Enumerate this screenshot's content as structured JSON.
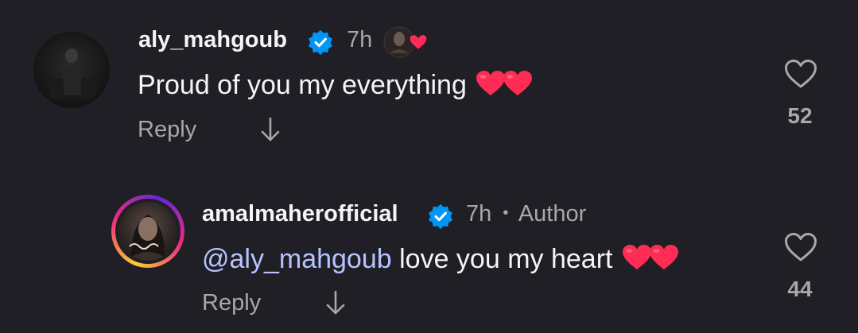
{
  "comments": [
    {
      "username": "aly_mahgoub",
      "time": "7h",
      "text": "Proud of you my everything",
      "reply_label": "Reply",
      "like_count": "52"
    },
    {
      "username": "amalmaherofficial",
      "time": "7h",
      "separator": "•",
      "author_label": "Author",
      "mention": "@aly_mahgoub",
      "text": " love you my heart",
      "reply_label": "Reply",
      "like_count": "44"
    }
  ],
  "colors": {
    "background": "#1f1f25",
    "verified": "#0095f6",
    "heart": "#ff2d55",
    "mention": "#b7c3ff",
    "muted": "#a8a8a8"
  },
  "icons": [
    "verified-badge-icon",
    "heart-outline-icon",
    "arrow-down-icon",
    "heart-emoji-icon",
    "story-reaction-badge"
  ]
}
